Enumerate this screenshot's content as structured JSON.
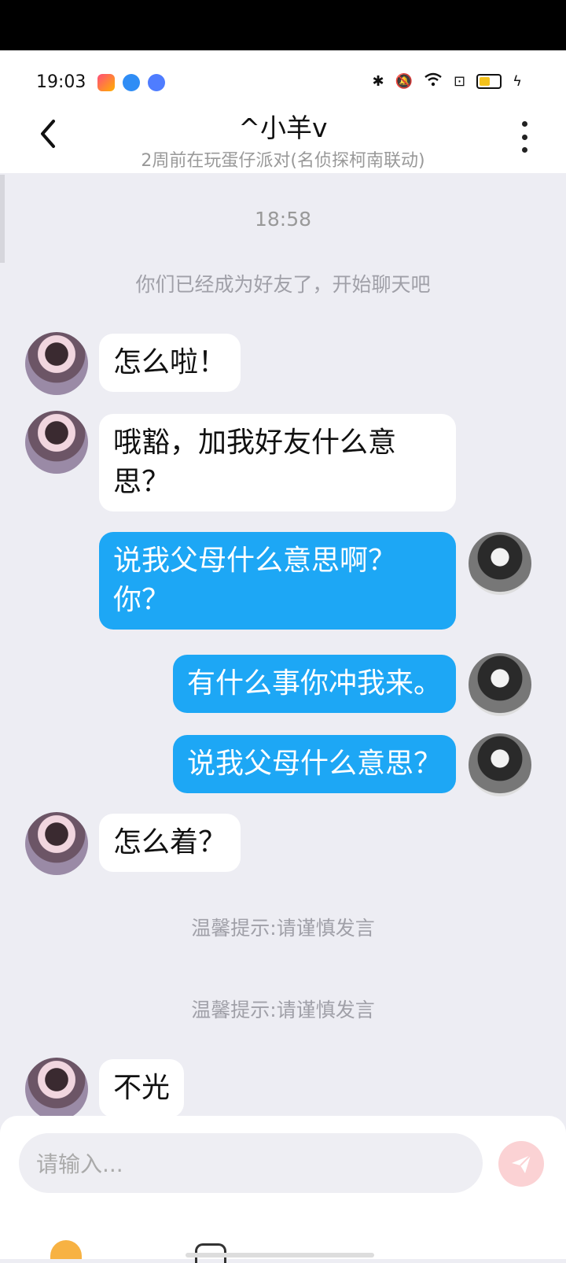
{
  "status": {
    "time": "19:03"
  },
  "header": {
    "back_icon": "chevron-left-icon",
    "title": "^小羊v",
    "subtitle": "2周前在玩蛋仔派对(名侦探柯南联动)",
    "more_icon": "more-vert-icon"
  },
  "chat": {
    "timestamp": "18:58",
    "system_friend": "你们已经成为好友了，开始聊天吧",
    "messages": [
      {
        "from": "other",
        "text": "怎么啦！"
      },
      {
        "from": "other",
        "text": "哦豁，加我好友什么意思？"
      },
      {
        "from": "self",
        "text": "说我父母什么意思啊？你？"
      },
      {
        "from": "self",
        "text": "有什么事你冲我来。"
      },
      {
        "from": "self",
        "text": "说我父母什么意思？"
      },
      {
        "from": "other",
        "text": "怎么着？"
      },
      {
        "from": "other",
        "text": "不光"
      }
    ],
    "tip1": "温馨提示:请谨慎发言",
    "tip2": "温馨提示:请谨慎发言"
  },
  "input": {
    "placeholder": "请输入...",
    "send_icon": "send-icon"
  },
  "colors": {
    "accent_blue": "#1da7f5",
    "send_pink": "#fbd2d4",
    "background": "#ededf3"
  }
}
